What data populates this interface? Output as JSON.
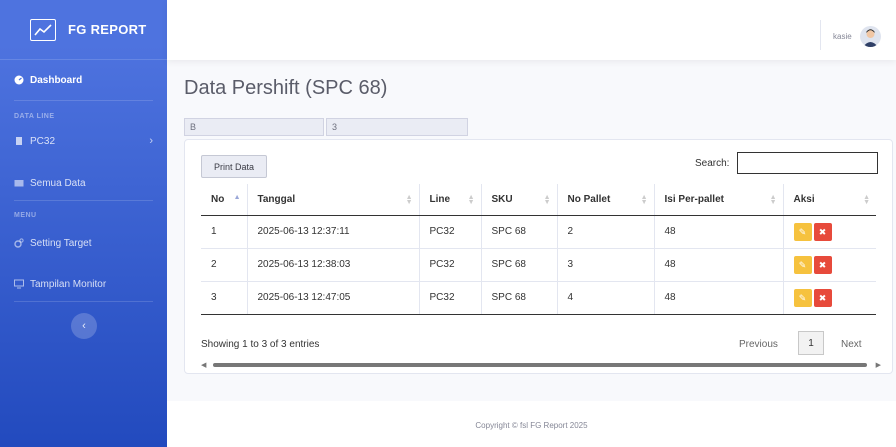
{
  "sidebar": {
    "brand": "FG REPORT",
    "dashboard": "Dashboard",
    "heading_data_line": "DATA LINE",
    "pc32": "PC32",
    "semua_data": "Semua Data",
    "heading_menu": "MENU",
    "setting_target": "Setting Target",
    "tampilan_monitor": "Tampilan Monitor"
  },
  "topbar": {
    "user": "kasie"
  },
  "page": {
    "title": "Data Pershift (SPC 68)",
    "filter_shift": "B",
    "filter_num": "3"
  },
  "table": {
    "print_label": "Print Data",
    "search_label": "Search:",
    "search_value": "",
    "columns": [
      "No",
      "Tanggal",
      "Line",
      "SKU",
      "No Pallet",
      "Isi Per-pallet",
      "Aksi"
    ],
    "rows": [
      {
        "no": "1",
        "tanggal": "2025-06-13 12:37:11",
        "line": "PC32",
        "sku": "SPC 68",
        "pallet": "2",
        "isi": "48"
      },
      {
        "no": "2",
        "tanggal": "2025-06-13 12:38:03",
        "line": "PC32",
        "sku": "SPC 68",
        "pallet": "3",
        "isi": "48"
      },
      {
        "no": "3",
        "tanggal": "2025-06-13 12:47:05",
        "line": "PC32",
        "sku": "SPC 68",
        "pallet": "4",
        "isi": "48"
      }
    ],
    "info": "Showing 1 to 3 of 3 entries",
    "previous": "Previous",
    "page": "1",
    "next": "Next"
  },
  "footer": {
    "copyright": "Copyright © fsl FG Report 2025"
  },
  "colors": {
    "sidebar_start": "#4e73df",
    "sidebar_end": "#224abe",
    "edit": "#f6c23e",
    "delete": "#e74a3b"
  }
}
